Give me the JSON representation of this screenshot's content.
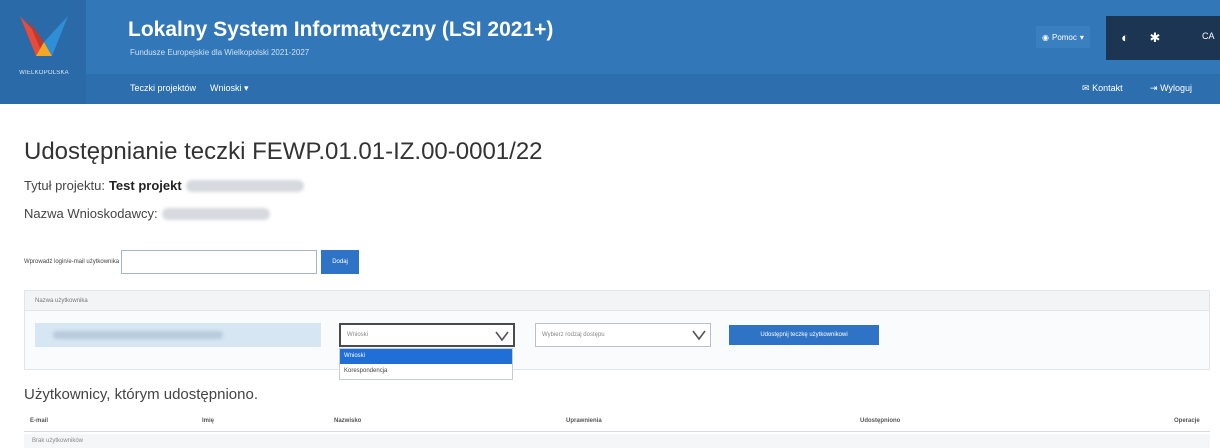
{
  "header": {
    "logo_text": "WIELKOPOLSKA",
    "title": "Lokalny System Informatyczny (LSI 2021+)",
    "subtitle": "Fundusze Europejskie dla Wielkopolski 2021-2027",
    "user_menu_label": "Pomoc",
    "right_text": "CA",
    "brand_color": "#3277b8"
  },
  "nav": {
    "items": [
      "Teczki projektów",
      "Wnioski"
    ],
    "right_items": [
      "Kontakt",
      "Wyloguj"
    ]
  },
  "page": {
    "title": "Udostępnianie teczki FEWP.01.01-IZ.00-0001/22",
    "project_label": "Tytuł projektu:",
    "project_value": "Test projekt",
    "applicant_label": "Nazwa Wnioskodawcy:"
  },
  "login": {
    "label": "Wprowadź login/e-mail użytkownika",
    "input_value": "",
    "button_label": "Dodaj"
  },
  "share_panel": {
    "header": "Nazwa użytkownika",
    "role_select_value": "Wnioski",
    "access_select_placeholder": "Wybierz rodzaj dostępu",
    "share_button_label": "Udostępnij teczkę użytkownikowi",
    "dropdown_options": [
      "Wnioski",
      "Korespondencja"
    ],
    "dropdown_selected": "Wnioski"
  },
  "users_table": {
    "section_title": "Użytkownicy, którym udostępniono.",
    "columns": [
      "E-mail",
      "Imię",
      "Nazwisko",
      "Uprawnienia",
      "Udostępniono",
      "Operacje"
    ],
    "empty_text": "Brak użytkowników"
  }
}
